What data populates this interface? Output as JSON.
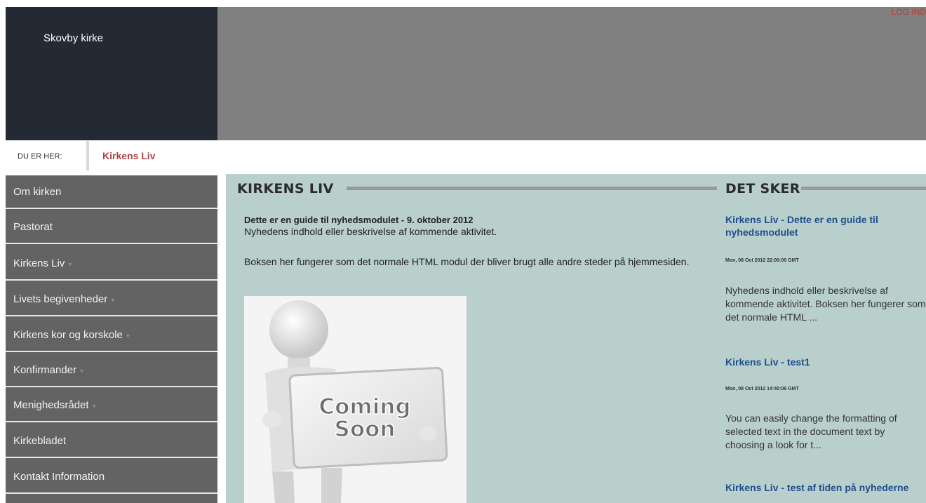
{
  "header": {
    "site_title": "Skovby kirke",
    "login_label": "LOG IND"
  },
  "breadcrumb": {
    "label": "DU ER HER:",
    "current": "Kirkens Liv"
  },
  "sidebar": {
    "items": [
      {
        "label": "Om kirken",
        "has_submenu": false
      },
      {
        "label": "Pastorat",
        "has_submenu": false
      },
      {
        "label": "Kirkens Liv",
        "has_submenu": true
      },
      {
        "label": "Livets begivenheder",
        "has_submenu": true
      },
      {
        "label": "Kirkens kor og korskole",
        "has_submenu": true
      },
      {
        "label": "Konfirmander",
        "has_submenu": true
      },
      {
        "label": "Menighedsrådet",
        "has_submenu": true
      },
      {
        "label": "Kirkebladet",
        "has_submenu": false
      },
      {
        "label": "Kontakt Information",
        "has_submenu": false
      }
    ]
  },
  "main": {
    "heading": "KIRKENS LIV",
    "article": {
      "title": "Dette er en guide til nyhedsmodulet - 9. oktober 2012",
      "summary": "Nyhedens indhold eller beskrivelse af kommende aktivitet.",
      "body": "Boksen her fungerer som det normale HTML modul der bliver brugt alle andre steder på hjemmesiden.",
      "image_text_line1": "Coming",
      "image_text_line2": "Soon"
    }
  },
  "events": {
    "heading": "DET SKER",
    "items": [
      {
        "title": "Kirkens Liv - Dette er en guide til nyhedsmodulet",
        "date": "Mon, 08 Oct 2012 22:00:00 GMT",
        "text": "Nyhedens indhold eller beskrivelse af kommende aktivitet. Boksen her fungerer som det normale HTML ..."
      },
      {
        "title": "Kirkens Liv - test1",
        "date": "Mon, 08 Oct 2012 14:40:06 GMT",
        "text": "You can easily change the formatting of selected text in the document text by choosing a look for t..."
      },
      {
        "title": "Kirkens Liv - test af tiden på nyhederne",
        "date": "",
        "text": ""
      }
    ]
  },
  "icons": {
    "submenu_arrow": "chevron-down-icon"
  },
  "colors": {
    "logo_bg": "#232a33",
    "banner_bg": "#808080",
    "sidebar_bg": "#636363",
    "content_bg": "#b8cfcc",
    "accent_red": "#a94442",
    "link_blue": "#1f4e8c"
  }
}
